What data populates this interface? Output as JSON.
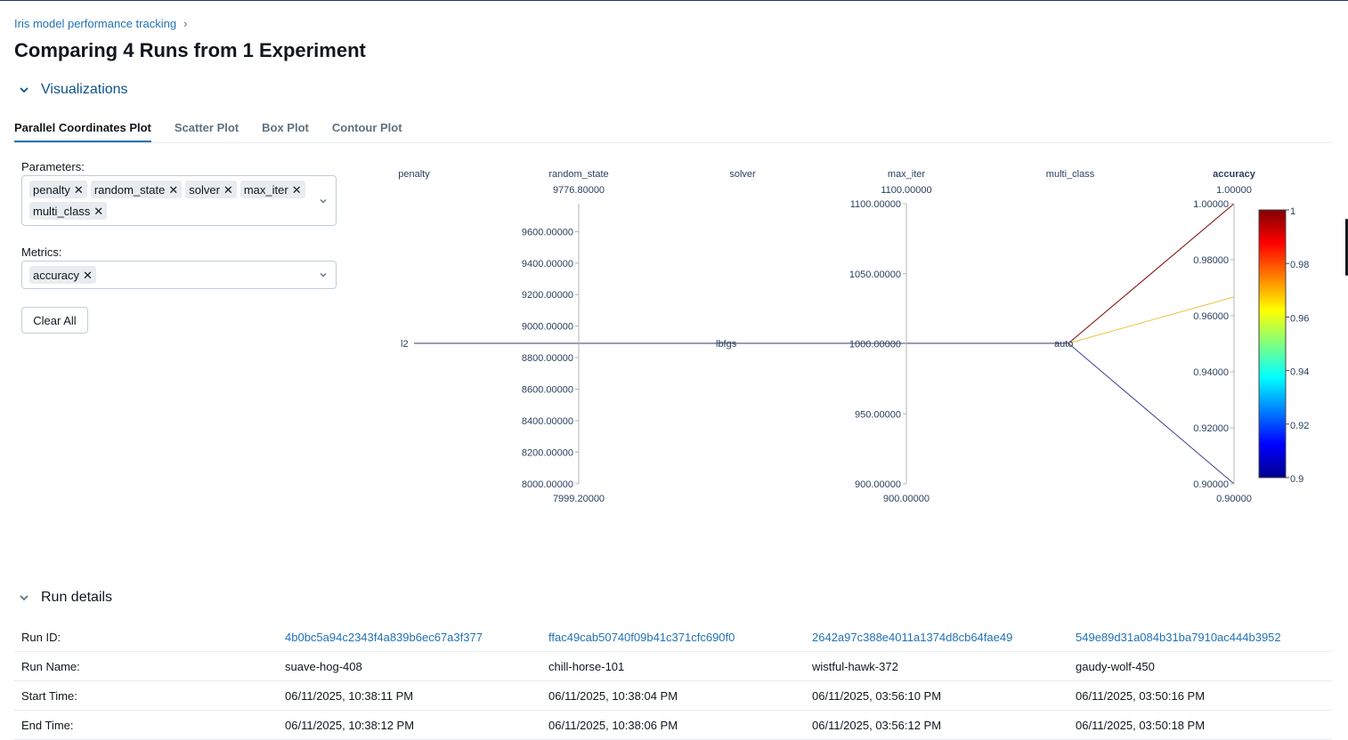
{
  "breadcrumb": {
    "experiment": "Iris model performance tracking",
    "separator": "›"
  },
  "page_title": "Comparing 4 Runs from 1 Experiment",
  "visualizations": {
    "label": "Visualizations",
    "tabs": [
      "Parallel Coordinates Plot",
      "Scatter Plot",
      "Box Plot",
      "Contour Plot"
    ],
    "active_tab": "Parallel Coordinates Plot"
  },
  "parameters": {
    "label": "Parameters:",
    "selected": [
      "penalty",
      "random_state",
      "solver",
      "max_iter",
      "multi_class"
    ]
  },
  "metrics": {
    "label": "Metrics:",
    "selected": [
      "accuracy"
    ]
  },
  "clear_all_label": "Clear All",
  "chip_remove_glyph": "✕",
  "chart_data": {
    "type": "parallel_coordinates",
    "dimensions": [
      {
        "name": "penalty",
        "kind": "categorical",
        "categories": [
          "l2"
        ]
      },
      {
        "name": "random_state",
        "kind": "numeric",
        "range_label_top": "9776.80000",
        "range_label_bottom": "7999.20000",
        "ticks": [
          "9600.00000",
          "9400.00000",
          "9200.00000",
          "9000.00000",
          "8800.00000",
          "8600.00000",
          "8400.00000",
          "8200.00000",
          "8000.00000"
        ]
      },
      {
        "name": "solver",
        "kind": "categorical",
        "categories": [
          "lbfgs"
        ]
      },
      {
        "name": "max_iter",
        "kind": "numeric",
        "range_label_top": "1100.00000",
        "range_label_bottom": "900.00000",
        "ticks": [
          "1100.00000",
          "1050.00000",
          "1000.00000",
          "950.00000",
          "900.00000"
        ]
      },
      {
        "name": "multi_class",
        "kind": "categorical",
        "categories": [
          "auto"
        ]
      },
      {
        "name": "accuracy",
        "kind": "metric",
        "range_label_top": "1.00000",
        "range_label_bottom": "0.90000",
        "ticks": [
          "1.00000",
          "0.98000",
          "0.96000",
          "0.94000",
          "0.92000",
          "0.90000"
        ]
      }
    ],
    "runs": [
      {
        "penalty": "l2",
        "random_state": null,
        "solver": "lbfgs",
        "max_iter": 1000,
        "multi_class": "auto",
        "accuracy": 1.0,
        "color": "#8b1a1a"
      },
      {
        "penalty": "l2",
        "random_state": null,
        "solver": "lbfgs",
        "max_iter": 1000,
        "multi_class": "auto",
        "accuracy": 1.0,
        "color": "#8b1a1a"
      },
      {
        "penalty": "l2",
        "random_state": null,
        "solver": "lbfgs",
        "max_iter": 1000,
        "multi_class": "auto",
        "accuracy": 0.9667,
        "color": "#e6b820"
      },
      {
        "penalty": "l2",
        "random_state": null,
        "solver": "lbfgs",
        "max_iter": 1000,
        "multi_class": "auto",
        "accuracy": 0.9,
        "color": "#1a237e"
      }
    ],
    "colorbar": {
      "min": 0.9,
      "max": 1.0,
      "ticks": [
        "1",
        "0.98",
        "0.96",
        "0.94",
        "0.92",
        "0.9"
      ],
      "colorscale": "jet"
    },
    "highlight_color": "#128912"
  },
  "run_details": {
    "label": "Run details",
    "rows": [
      {
        "label": "Run ID:",
        "link": true,
        "values": [
          "4b0bc5a94c2343f4a839b6ec67a3f377",
          "ffac49cab50740f09b41c371cfc690f0",
          "2642a97c388e4011a1374d8cb64fae49",
          "549e89d31a084b31ba7910ac444b3952"
        ]
      },
      {
        "label": "Run Name:",
        "link": false,
        "values": [
          "suave-hog-408",
          "chill-horse-101",
          "wistful-hawk-372",
          "gaudy-wolf-450"
        ]
      },
      {
        "label": "Start Time:",
        "link": false,
        "values": [
          "06/11/2025, 10:38:11 PM",
          "06/11/2025, 10:38:04 PM",
          "06/11/2025, 03:56:10 PM",
          "06/11/2025, 03:50:16 PM"
        ]
      },
      {
        "label": "End Time:",
        "link": false,
        "values": [
          "06/11/2025, 10:38:12 PM",
          "06/11/2025, 10:38:06 PM",
          "06/11/2025, 03:56:12 PM",
          "06/11/2025, 03:50:18 PM"
        ]
      }
    ]
  }
}
